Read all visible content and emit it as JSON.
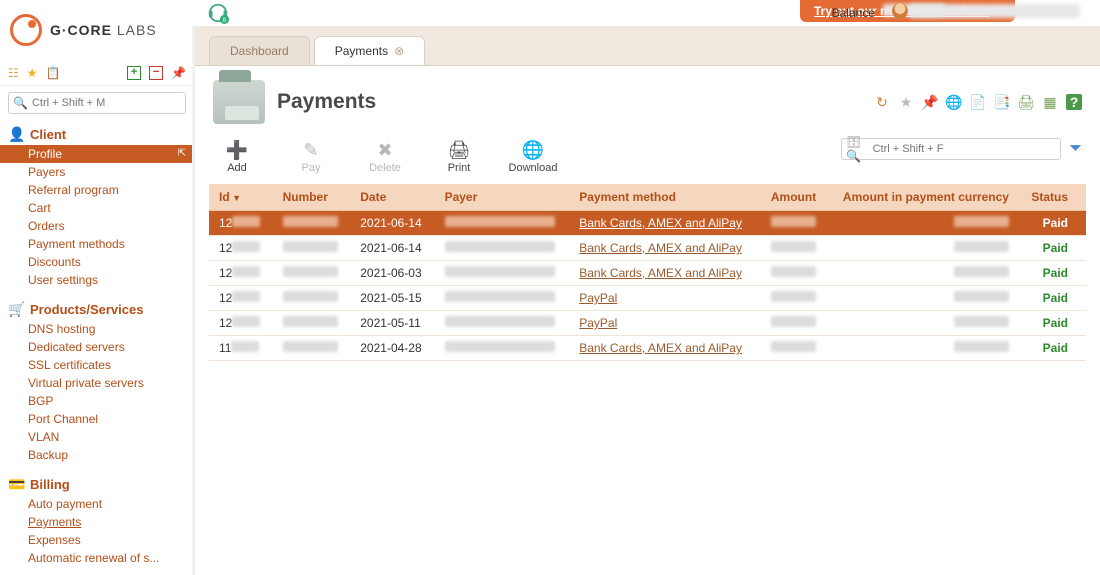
{
  "brand": {
    "name_bold": "G·CORE",
    "name_rest": " LABS"
  },
  "topbar": {
    "try_label": "Try out our new user interface!",
    "balance_label": "Balance"
  },
  "sidebar": {
    "search_placeholder": "Ctrl + Shift + M",
    "sections": [
      {
        "icon": "👤",
        "title": "Client",
        "items": [
          "Profile",
          "Payers",
          "Referral program",
          "Cart",
          "Orders",
          "Payment methods",
          "Discounts",
          "User settings"
        ],
        "active": "Profile"
      },
      {
        "icon": "🛒",
        "title": "Products/Services",
        "items": [
          "DNS hosting",
          "Dedicated servers",
          "SSL certificates",
          "Virtual private servers",
          "BGP",
          "Port Channel",
          "VLAN",
          "Backup"
        ]
      },
      {
        "icon": "💳",
        "title": "Billing",
        "items": [
          "Auto payment",
          "Payments",
          "Expenses",
          "Automatic renewal of s..."
        ],
        "current": "Payments"
      }
    ],
    "tool_icons": [
      "list",
      "star",
      "clipboard",
      "plus",
      "minus",
      "pin"
    ]
  },
  "tabs": [
    {
      "label": "Dashboard",
      "active": false,
      "closable": false
    },
    {
      "label": "Payments",
      "active": true,
      "closable": true
    }
  ],
  "page": {
    "title": "Payments",
    "head_icons": [
      "refresh",
      "star",
      "pin",
      "globe",
      "copy",
      "doc",
      "print",
      "table",
      "help"
    ]
  },
  "actions": [
    {
      "label": "Add",
      "icon": "➕",
      "enabled": true
    },
    {
      "label": "Pay",
      "icon": "✎",
      "enabled": false
    },
    {
      "label": "Delete",
      "icon": "✖",
      "enabled": false
    },
    {
      "label": "Print",
      "icon": "🖨",
      "enabled": true
    },
    {
      "label": "Download",
      "icon": "🌐",
      "enabled": true
    }
  ],
  "quick_search_placeholder": "Ctrl + Shift + F",
  "table": {
    "columns": [
      "Id",
      "Number",
      "Date",
      "Payer",
      "Payment method",
      "Amount",
      "Amount in payment currency",
      "Status"
    ],
    "sorted_column": "Id",
    "rows": [
      {
        "id_prefix": "12",
        "date": "2021-06-14",
        "method": "Bank Cards, AMEX and AliPay",
        "status": "Paid",
        "selected": true
      },
      {
        "id_prefix": "12",
        "date": "2021-06-14",
        "method": "Bank Cards, AMEX and AliPay",
        "status": "Paid",
        "selected": false
      },
      {
        "id_prefix": "12",
        "date": "2021-06-03",
        "method": "Bank Cards, AMEX and AliPay",
        "status": "Paid",
        "selected": false
      },
      {
        "id_prefix": "12",
        "date": "2021-05-15",
        "method": "PayPal",
        "status": "Paid",
        "selected": false
      },
      {
        "id_prefix": "12",
        "date": "2021-05-11",
        "method": "PayPal",
        "status": "Paid",
        "selected": false
      },
      {
        "id_prefix": "11",
        "date": "2021-04-28",
        "method": "Bank Cards, AMEX and AliPay",
        "status": "Paid",
        "selected": false
      }
    ]
  }
}
